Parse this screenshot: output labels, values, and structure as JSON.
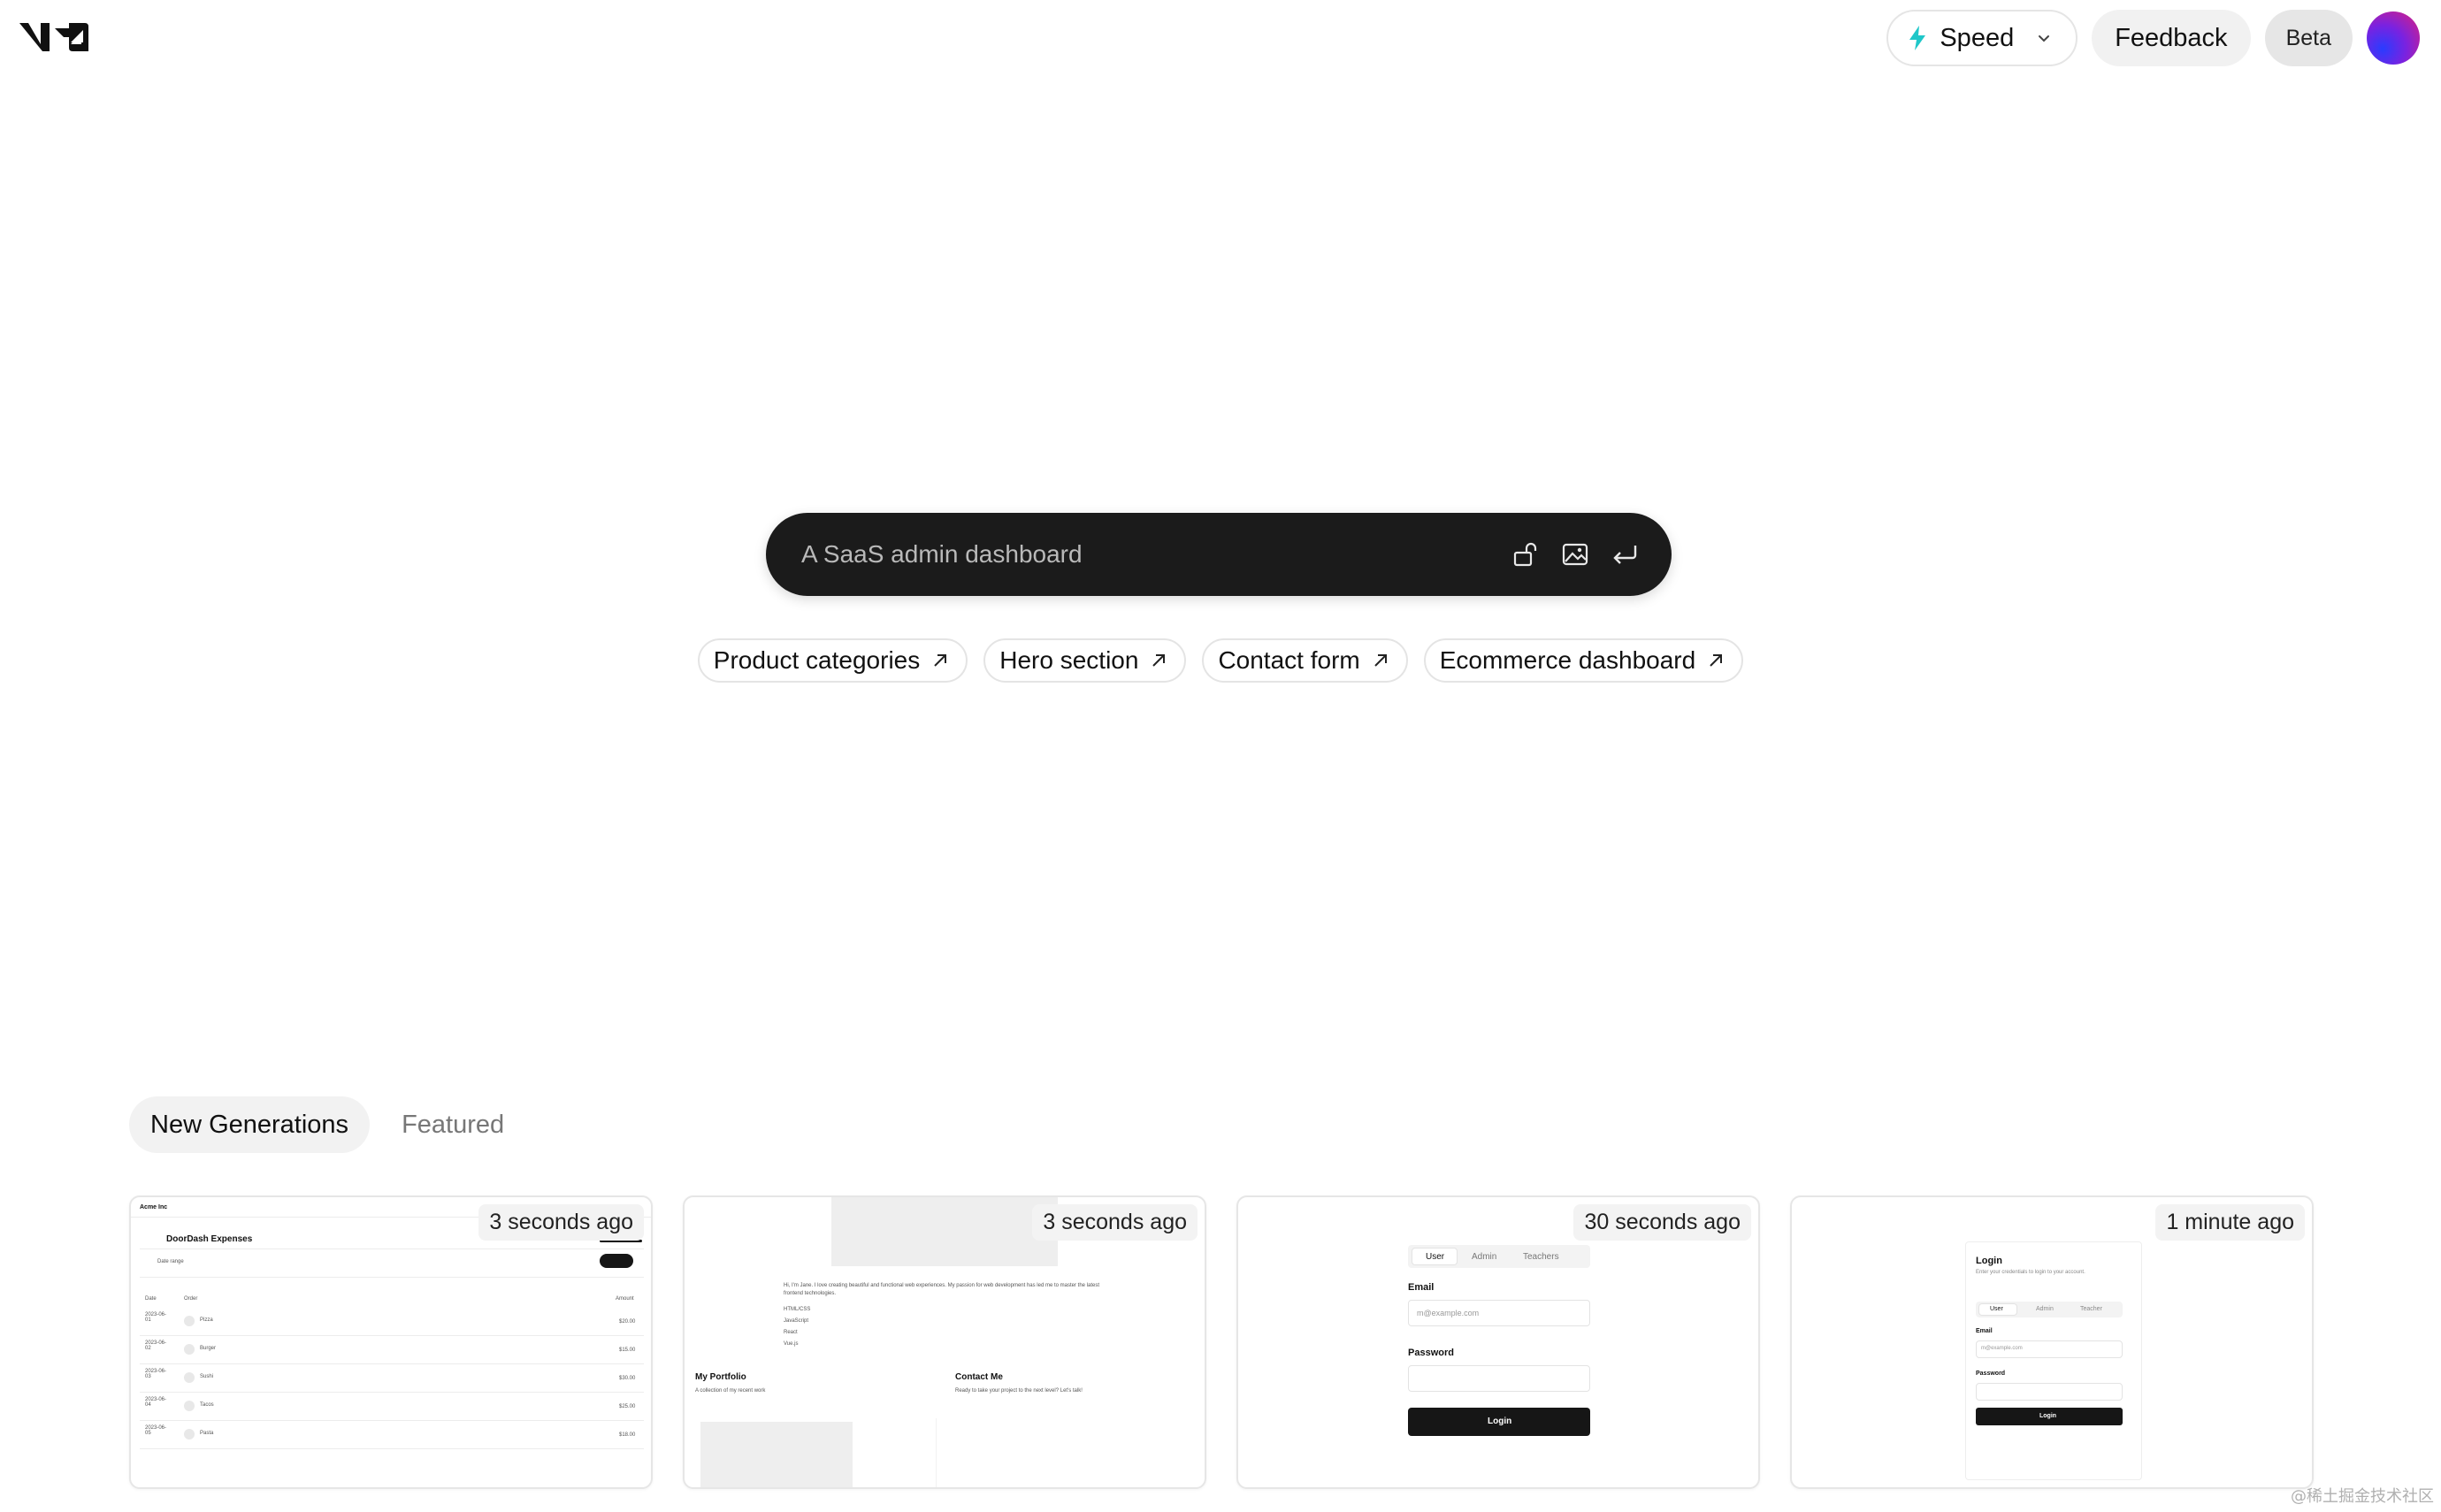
{
  "header": {
    "logo_name": "v0-logo",
    "speed_label": "Speed",
    "feedback_label": "Feedback",
    "beta_label": "Beta"
  },
  "prompt": {
    "placeholder": "A SaaS admin dashboard"
  },
  "suggestions": [
    {
      "label": "Product categories"
    },
    {
      "label": "Hero section"
    },
    {
      "label": "Contact form"
    },
    {
      "label": "Ecommerce dashboard"
    }
  ],
  "tabs": [
    {
      "label": "New Generations",
      "active": true
    },
    {
      "label": "Featured",
      "active": false
    }
  ],
  "cards": [
    {
      "time": "3 seconds ago",
      "preview": {
        "brand": "Acme Inc",
        "title": "DoorDash Expenses",
        "date_range": "Date range",
        "col_date": "Date",
        "col_order": "Order",
        "col_amount": "Amount",
        "rows": [
          {
            "date": "2023-06-01",
            "item": "Pizza",
            "amount": "$20.00"
          },
          {
            "date": "2023-06-02",
            "item": "Burger",
            "amount": "$15.00"
          },
          {
            "date": "2023-06-03",
            "item": "Sushi",
            "amount": "$30.00"
          },
          {
            "date": "2023-06-04",
            "item": "Tacos",
            "amount": "$25.00"
          },
          {
            "date": "2023-06-05",
            "item": "Pasta",
            "amount": "$18.00"
          }
        ]
      }
    },
    {
      "time": "3 seconds ago",
      "preview": {
        "intro": "Hi, I'm Jane. I love creating beautiful and functional web experiences. My passion for web development has led me to master the latest frontend technologies.",
        "skills": [
          "HTML/CSS",
          "JavaScript",
          "React",
          "Vue.js"
        ],
        "portfolio_title": "My Portfolio",
        "portfolio_sub": "A collection of my recent work",
        "contact_title": "Contact Me",
        "contact_sub": "Ready to take your project to the next level? Let's talk!"
      }
    },
    {
      "time": "30 seconds ago",
      "preview": {
        "tabs": [
          "User",
          "Admin",
          "Teachers"
        ],
        "email_label": "Email",
        "email_placeholder": "m@example.com",
        "password_label": "Password",
        "button": "Login"
      }
    },
    {
      "time": "1 minute ago",
      "preview": {
        "title": "Login",
        "subtitle": "Enter your credentials to login to your account.",
        "tabs": [
          "User",
          "Admin",
          "Teacher"
        ],
        "email_label": "Email",
        "email_placeholder": "m@example.com",
        "password_label": "Password",
        "button": "Login"
      }
    }
  ],
  "watermark": "@稀土掘金技术社区"
}
